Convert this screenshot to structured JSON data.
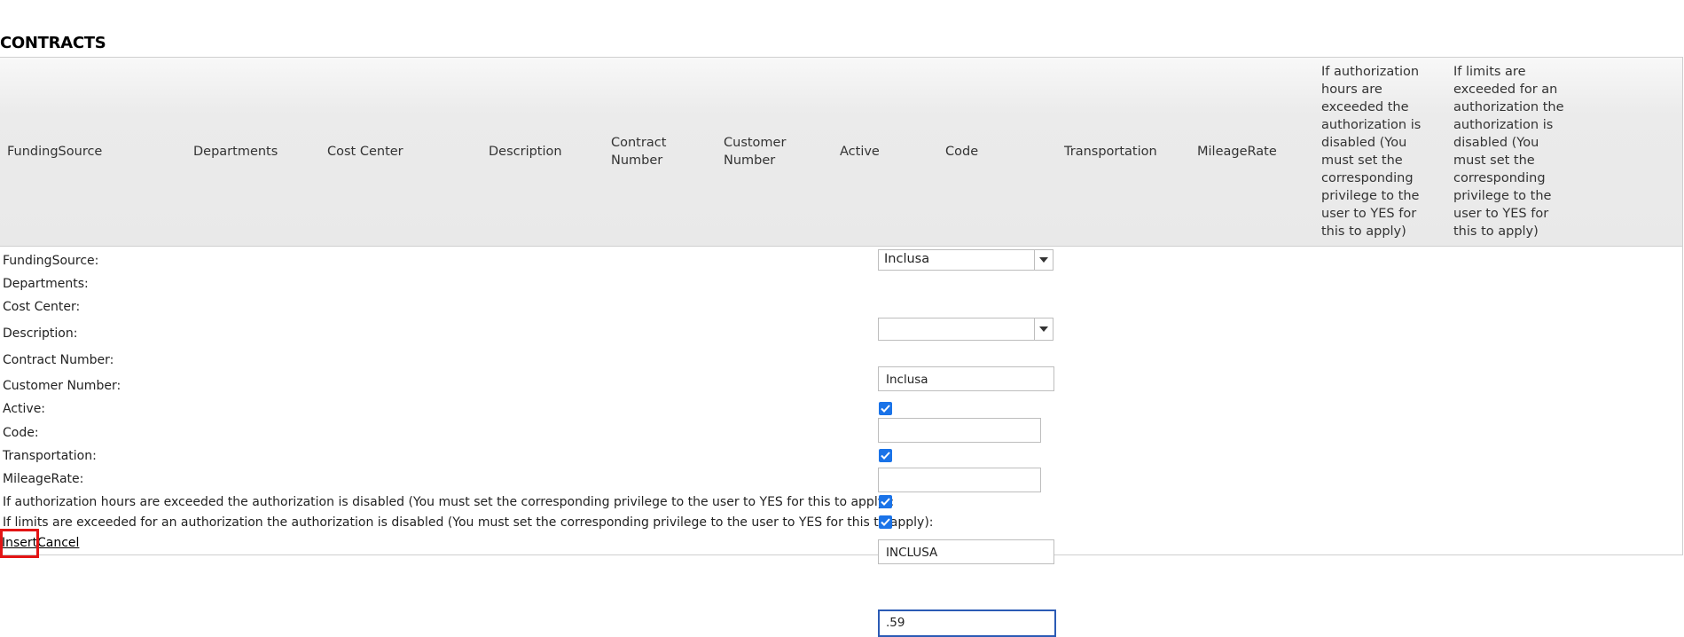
{
  "page_title": "CONTRACTS",
  "columns": [
    "FundingSource",
    "Departments",
    "Cost Center",
    "Description",
    "Contract Number",
    "Customer Number",
    "Active",
    "Code",
    "Transportation",
    "MileageRate",
    "If authorization hours are exceeded the authorization is disabled (You must set the corresponding privilege to the user to YES for this to apply)",
    "If limits are exceeded for an authorization the authorization is disabled (You must set the corresponding privilege to the user to YES for this to apply)"
  ],
  "form": {
    "funding_source": {
      "label": "FundingSource:",
      "value": "Inclusa"
    },
    "departments": {
      "label": "Departments:"
    },
    "cost_center": {
      "label": "Cost Center:",
      "value": ""
    },
    "description": {
      "label": "Description:",
      "value": "Inclusa"
    },
    "contract_number": {
      "label": "Contract Number:",
      "value": ""
    },
    "customer_number": {
      "label": "Customer Number:",
      "value": ""
    },
    "active": {
      "label": "Active:",
      "checked": true
    },
    "code": {
      "label": "Code:",
      "value": "INCLUSA"
    },
    "transportation": {
      "label": "Transportation:",
      "checked": true
    },
    "mileage_rate": {
      "label": "MileageRate:",
      "value": ".59"
    },
    "auth_hours": {
      "label": "If authorization hours are exceeded the authorization is disabled (You must set the corresponding privilege to the user to YES for this to apply):",
      "checked": true
    },
    "limits": {
      "label": "If limits are exceeded for an authorization the authorization is disabled (You must set the corresponding privilege to the user to YES for this to apply):",
      "checked": true
    }
  },
  "actions": {
    "insert": "Insert",
    "cancel": "Cancel"
  },
  "colors": {
    "focus_border": "#2b5bb5",
    "checkbox": "#1a73e8",
    "highlight": "#e31414",
    "header_bg": "#e9e9e9"
  },
  "icons": {
    "dropdown": "chevron-down-icon",
    "check": "checkmark-icon"
  }
}
